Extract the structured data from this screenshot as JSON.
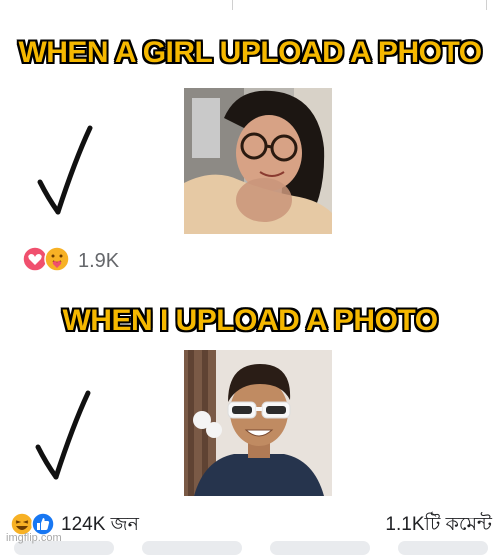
{
  "captions": {
    "girl": "WHEN A GIRL UPLOAD A PHOTO",
    "me": "WHEN I UPLOAD A PHOTO"
  },
  "post1": {
    "reaction_icons": [
      "love-icon",
      "care-icon"
    ],
    "reaction_count": "1.9K"
  },
  "post2": {
    "reaction_icons": [
      "haha-icon",
      "like-icon"
    ],
    "reaction_count": "124K জন",
    "comment_count": "1.1Kটি কমেন্ট"
  },
  "watermark": "imgflip.com",
  "colors": {
    "caption_fill": "#f5b800",
    "caption_stroke": "#000000",
    "love": "#f0506e",
    "like": "#1877f2",
    "haha": "#f7b125"
  }
}
